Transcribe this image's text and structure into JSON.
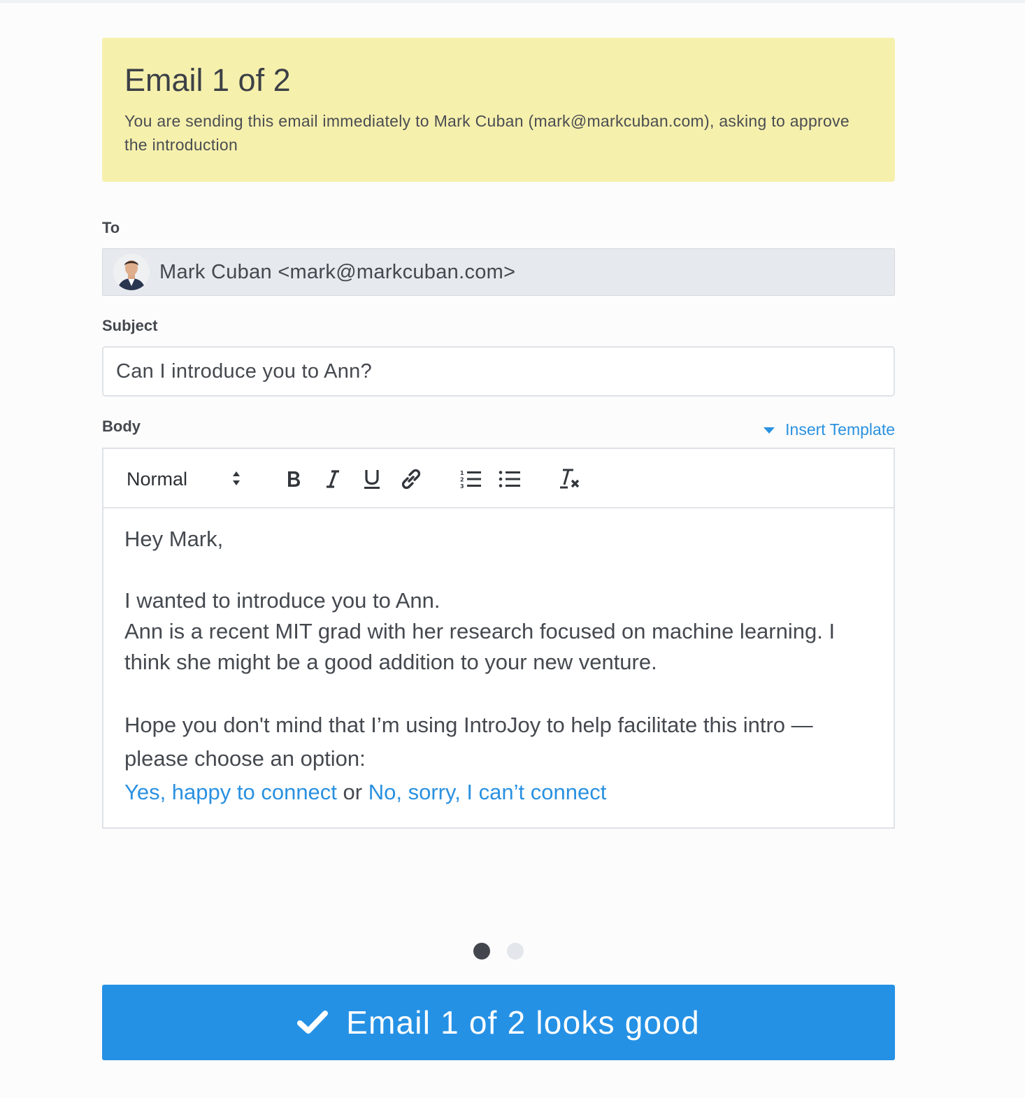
{
  "notice": {
    "title": "Email 1 of 2",
    "description": "You are sending this email immediately to Mark Cuban (mark@markcuban.com), asking to approve the introduction"
  },
  "to": {
    "label": "To",
    "value": "Mark Cuban <mark@markcuban.com>"
  },
  "subject": {
    "label": "Subject",
    "value": "Can I introduce you to Ann?"
  },
  "body": {
    "label": "Body",
    "insert_template": "Insert Template",
    "toolbar": {
      "format": "Normal",
      "icons": [
        "bold-icon",
        "italic-icon",
        "underline-icon",
        "link-icon",
        "ordered-list-icon",
        "bullet-list-icon",
        "clear-format-icon"
      ]
    },
    "greeting": "Hey Mark,",
    "line1": "I wanted to introduce you to Ann.",
    "line2": "Ann is a recent MIT grad with her research focused on machine learning. I think she might be a good addition to your new venture.",
    "line3": "Hope you don't mind that I’m using IntroJoy to help facilitate this intro — please choose an option:",
    "option_yes": "Yes, happy to connect",
    "option_or": "or",
    "option_no": "No, sorry, I can’t connect"
  },
  "pagination": {
    "current": 1,
    "total": 2
  },
  "confirm_button": {
    "label": "Email 1 of 2 looks good",
    "icon": "check-icon"
  },
  "colors": {
    "accent": "#2591e5",
    "notice_bg": "#f6f0ad",
    "link": "#2a91e0"
  }
}
